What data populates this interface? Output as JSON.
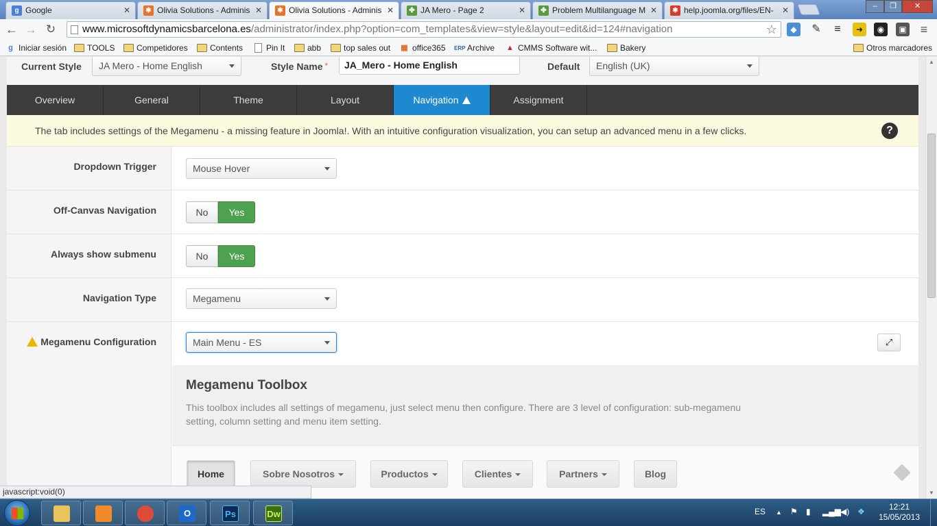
{
  "browser": {
    "tabs": [
      {
        "title": "Google",
        "icon": "google-icon",
        "color": "#4a7ed8"
      },
      {
        "title": "Olivia Solutions - Adminis",
        "icon": "joomla-icon",
        "color": "#e4742a"
      },
      {
        "title": "Olivia Solutions - Adminis",
        "icon": "joomla-icon",
        "color": "#e4742a"
      },
      {
        "title": "JA Mero - Page 2",
        "icon": "ja-icon",
        "color": "#5a9a3a"
      },
      {
        "title": "Problem Multilanguage M",
        "icon": "ja-icon",
        "color": "#5a9a3a"
      },
      {
        "title": "help.joomla.org/files/EN-",
        "icon": "joomla-icon",
        "color": "#d93b2b"
      }
    ],
    "url_host": "www.microsoftdynamicsbarcelona.es",
    "url_path": "/administrator/index.php?option=com_templates&view=style&layout=edit&id=124#navigation",
    "bookmarks": [
      {
        "label": "Iniciar sesión",
        "kind": "google"
      },
      {
        "label": "TOOLS",
        "kind": "folder"
      },
      {
        "label": "Competidores",
        "kind": "folder"
      },
      {
        "label": "Contents",
        "kind": "folder"
      },
      {
        "label": "Pin It",
        "kind": "doc"
      },
      {
        "label": "abb",
        "kind": "folder"
      },
      {
        "label": "top sales out",
        "kind": "folder"
      },
      {
        "label": "office365",
        "kind": "office"
      },
      {
        "label": "Archive",
        "kind": "erp"
      },
      {
        "label": "CMMS Software wit...",
        "kind": "cmms"
      },
      {
        "label": "Bakery",
        "kind": "folder"
      }
    ],
    "other_bookmarks": "Otros marcadores",
    "status_url": "javascript:void(0)"
  },
  "style_bar": {
    "current_style_label": "Current Style",
    "current_style_value": "JA Mero - Home English",
    "style_name_label": "Style Name",
    "required_mark": "*",
    "style_name_value": "JA_Mero - Home English",
    "default_label": "Default",
    "default_value": "English (UK)"
  },
  "tabs": [
    {
      "label": "Overview",
      "active": false
    },
    {
      "label": "General",
      "active": false
    },
    {
      "label": "Theme",
      "active": false
    },
    {
      "label": "Layout",
      "active": false
    },
    {
      "label": "Navigation",
      "active": true
    },
    {
      "label": "Assignment",
      "active": false
    }
  ],
  "notice": "The tab includes settings of the Megamenu - a missing feature in Joomla!. With an intuitive configuration visualization, you can setup an advanced menu in a few clicks.",
  "help_symbol": "?",
  "fields": {
    "dropdown_trigger": {
      "label": "Dropdown Trigger",
      "value": "Mouse Hover"
    },
    "off_canvas": {
      "label": "Off-Canvas Navigation",
      "no": "No",
      "yes": "Yes"
    },
    "always_submenu": {
      "label": "Always show submenu",
      "no": "No",
      "yes": "Yes"
    },
    "nav_type": {
      "label": "Navigation Type",
      "value": "Megamenu"
    },
    "megamenu_config": {
      "label": "Megamenu Configuration",
      "value": "Main Menu - ES"
    }
  },
  "toolbox": {
    "title": "Megamenu Toolbox",
    "description": "This toolbox includes all settings of megamenu, just select menu then configure. There are 3 level of configuration: sub-megamenu setting, column setting and menu item setting."
  },
  "menu_items": [
    {
      "label": "Home",
      "dropdown": false
    },
    {
      "label": "Sobre Nosotros",
      "dropdown": true
    },
    {
      "label": "Productos",
      "dropdown": true
    },
    {
      "label": "Clientes",
      "dropdown": true
    },
    {
      "label": "Partners",
      "dropdown": true
    },
    {
      "label": "Blog",
      "dropdown": false
    }
  ],
  "taskbar": {
    "apps": [
      {
        "icon": "explorer-icon",
        "label": "",
        "color": "#e8c55a"
      },
      {
        "icon": "media-player-icon",
        "label": "",
        "color": "#f08a2a"
      },
      {
        "icon": "chrome-icon",
        "label": "",
        "color": "#dd4b39"
      },
      {
        "icon": "outlook-icon",
        "label": "O",
        "color": "#1b6ac9"
      },
      {
        "icon": "photoshop-icon",
        "label": "Ps",
        "color": "#0c2b52"
      },
      {
        "icon": "dreamweaver-icon",
        "label": "Dw",
        "color": "#3c6e12"
      }
    ],
    "language": "ES",
    "time": "12:21",
    "date": "15/05/2013"
  },
  "colors": {
    "active_tab": "#1e88d0",
    "yes_green": "#4ea14e",
    "warning": "#f0b400"
  }
}
